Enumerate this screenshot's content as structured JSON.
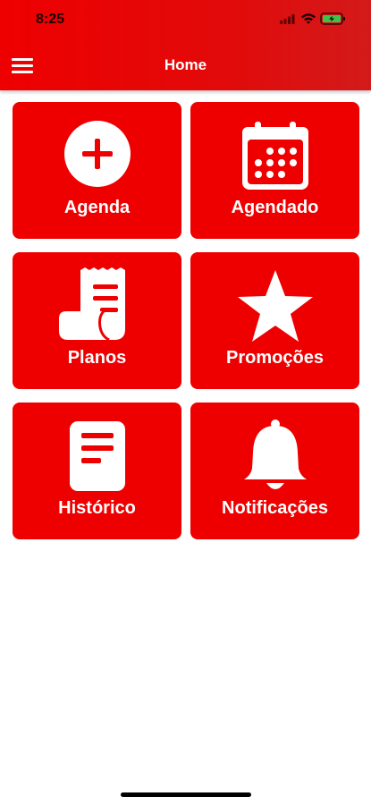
{
  "status_bar": {
    "time": "8:25"
  },
  "header": {
    "title": "Home"
  },
  "tiles": [
    {
      "label": "Agenda",
      "icon": "plus-circle-icon"
    },
    {
      "label": "Agendado",
      "icon": "calendar-icon"
    },
    {
      "label": "Planos",
      "icon": "receipt-icon"
    },
    {
      "label": "Promoções",
      "icon": "star-icon"
    },
    {
      "label": "Histórico",
      "icon": "document-icon"
    },
    {
      "label": "Notificações",
      "icon": "bell-icon"
    }
  ],
  "colors": {
    "accent": "#ee0000",
    "background": "#ffffff",
    "text_on_accent": "#ffffff"
  }
}
